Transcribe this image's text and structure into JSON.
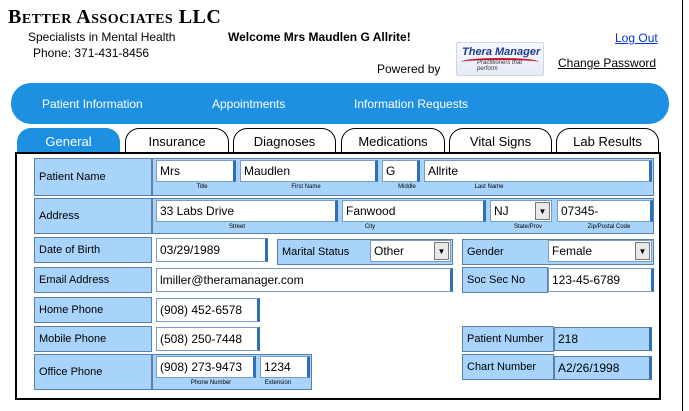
{
  "header": {
    "company_name": "Better Associates LLC",
    "tagline": "Specialists in Mental Health",
    "phone": "Phone: 371-431-8456",
    "welcome": "Welcome Mrs Maudlen G Allrite!",
    "powered_by": "Powered by",
    "logo_text": "Thera Manager",
    "logo_sub": "Practitioners that perform",
    "logout": "Log Out",
    "change_password": "Change Password"
  },
  "nav": {
    "items": [
      "Patient Information",
      "Appointments",
      "Information Requests"
    ]
  },
  "tabs": [
    "General",
    "Insurance",
    "Diagnoses",
    "Medications",
    "Vital Signs",
    "Lab Results"
  ],
  "colors": {
    "accent": "#1e90e2",
    "field_label_bg": "#a8d4fb"
  },
  "form": {
    "patient_name": {
      "label": "Patient Name",
      "title": {
        "value": "Mrs",
        "caption": "Title"
      },
      "first": {
        "value": "Maudlen",
        "caption": "First Name"
      },
      "middle": {
        "value": "G",
        "caption": "Middle"
      },
      "last": {
        "value": "Allrite",
        "caption": "Last Name"
      }
    },
    "address": {
      "label": "Address",
      "street": {
        "value": "33 Labs Drive",
        "caption": "Street"
      },
      "city": {
        "value": "Fanwood",
        "caption": "City"
      },
      "state": {
        "value": "NJ",
        "caption": "State/Prov"
      },
      "zip": {
        "value": "07345-",
        "caption": "Zip/Postal Code"
      }
    },
    "dob": {
      "label": "Date of Birth",
      "value": "03/29/1989"
    },
    "marital": {
      "label": "Marital Status",
      "value": "Other"
    },
    "gender": {
      "label": "Gender",
      "value": "Female"
    },
    "email": {
      "label": "Email Address",
      "value": "lmiller@theramanager.com"
    },
    "ssn": {
      "label": "Soc Sec No",
      "value": "123-45-6789"
    },
    "home_phone": {
      "label": "Home Phone",
      "value": "(908) 452-6578"
    },
    "mobile_phone": {
      "label": "Mobile Phone",
      "value": "(508) 250-7448"
    },
    "office_phone": {
      "label": "Office Phone",
      "value": "(908) 273-9473",
      "caption": "Phone Number",
      "extension": "1234",
      "ext_caption": "Extension"
    },
    "patient_number": {
      "label": "Patient Number",
      "value": "218"
    },
    "chart_number": {
      "label": "Chart Number",
      "value": "A2/26/1998"
    }
  }
}
